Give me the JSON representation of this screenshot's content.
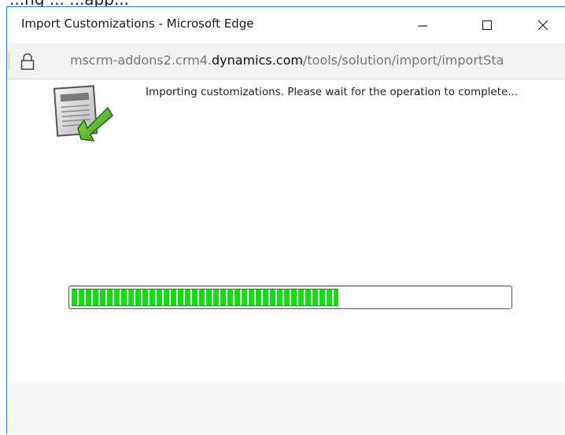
{
  "backdrop": {
    "text": "...ng ... ...app..."
  },
  "window": {
    "title": "Import Customizations - Microsoft Edge",
    "minimize_glyph": "—",
    "maximize_glyph": "☐",
    "close_glyph": "✕"
  },
  "address_bar": {
    "url_prefix": "mscrm-addons2.crm4.",
    "url_host": "dynamics.com",
    "url_path": "/tools/solution/import/importSta"
  },
  "content": {
    "status_message": "Importing customizations. Please wait for the operation to complete...",
    "icon": "import-document-icon"
  },
  "progress": {
    "percent": 61,
    "color": "#10e010"
  },
  "colors": {
    "window_border": "#2b79d8",
    "address_bar_bg": "#f2f2f2",
    "footer_bg": "#f6f6f6"
  }
}
